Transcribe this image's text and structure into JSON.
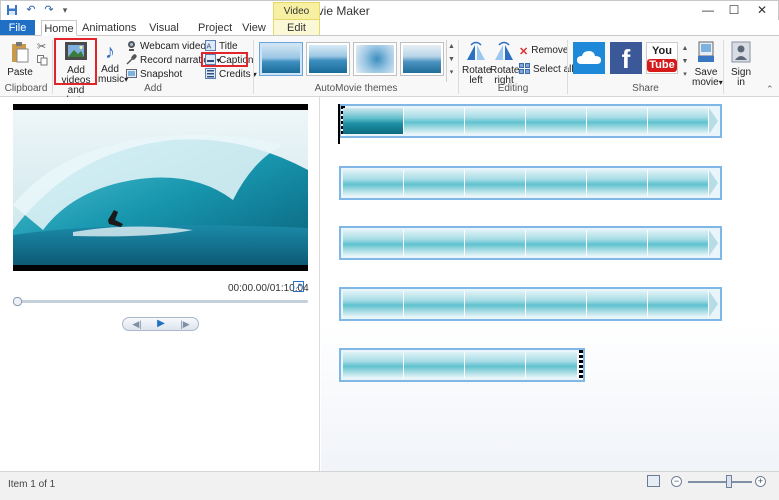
{
  "window": {
    "title": "Movie Maker",
    "qat": [
      "save-icon",
      "undo-icon",
      "redo-icon",
      "dropdown-icon"
    ],
    "controls": {
      "minimize": "—",
      "maximize": "☐",
      "close": "✕"
    }
  },
  "tabs": {
    "file": "File",
    "home": "Home",
    "animations": "Animations",
    "visual_effects": "Visual Effects",
    "project": "Project",
    "view": "View",
    "context_group": "Video Tools",
    "edit": "Edit"
  },
  "ribbon": {
    "clipboard": {
      "paste": "Paste",
      "label": "Clipboard"
    },
    "add": {
      "add_videos_1": "Add videos",
      "add_videos_2": "and photos",
      "add_music_1": "Add",
      "add_music_2": "music",
      "webcam_video": "Webcam video",
      "record_narration": "Record narration",
      "snapshot": "Snapshot",
      "title": "Title",
      "caption": "Caption",
      "credits": "Credits",
      "label": "Add"
    },
    "themes": {
      "label": "AutoMovie themes",
      "count": 5
    },
    "editing": {
      "rotate_left_1": "Rotate",
      "rotate_left_2": "left",
      "rotate_right_1": "Rotate",
      "rotate_right_2": "right",
      "remove": "Remove",
      "select_all": "Select all",
      "label": "Editing"
    },
    "share": {
      "label": "Share",
      "youtube_1": "You",
      "youtube_2": "Tube",
      "save_movie_1": "Save",
      "save_movie_2": "movie"
    },
    "sign_in": {
      "line1": "Sign",
      "line2": "in"
    }
  },
  "preview": {
    "timecode": "00:00.00/01:10.04"
  },
  "status": {
    "text": "Item 1 of 1",
    "zoom_minus": "−",
    "zoom_plus": "+"
  },
  "colors": {
    "accent": "#1f6fc5",
    "highlight_box": "#e0262b",
    "context_tab": "#f7f0a3",
    "strip_border": "#7fb8e6"
  }
}
